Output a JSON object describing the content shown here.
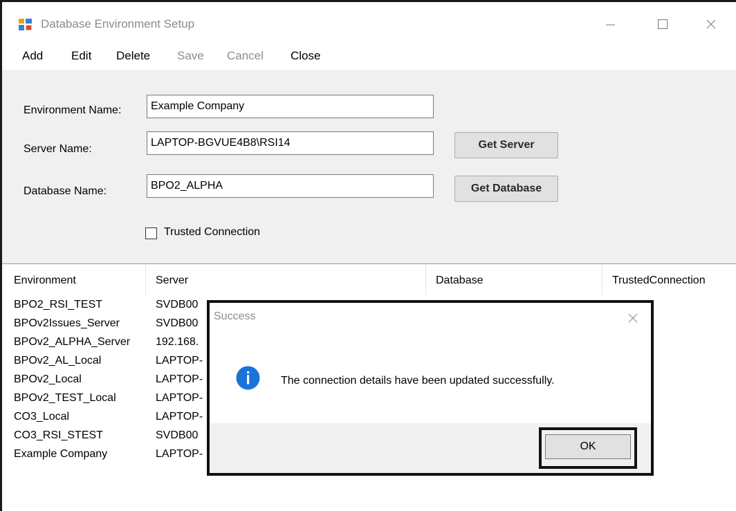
{
  "window": {
    "title": "Database Environment Setup"
  },
  "menu": {
    "add": "Add",
    "edit": "Edit",
    "delete": "Delete",
    "save": "Save",
    "cancel": "Cancel",
    "close": "Close"
  },
  "form": {
    "environment_label": "Environment Name:",
    "environment_value": "Example Company",
    "server_label": "Server Name:",
    "server_value": "LAPTOP-BGVUE4B8\\RSI14",
    "database_label": "Database Name:",
    "database_value": "BPO2_ALPHA",
    "get_server": "Get Server",
    "get_database": "Get Database",
    "trusted_label": "Trusted Connection",
    "trusted_checked": false
  },
  "list": {
    "columns": [
      "Environment",
      "Server",
      "Database",
      "TrustedConnection"
    ],
    "rows": [
      {
        "environment": "BPO2_RSI_TEST",
        "server": "SVDB00"
      },
      {
        "environment": "BPOv2Issues_Server",
        "server": "SVDB00"
      },
      {
        "environment": "BPOv2_ALPHA_Server",
        "server": "192.168."
      },
      {
        "environment": "BPOv2_AL_Local",
        "server": "LAPTOP-"
      },
      {
        "environment": "BPOv2_Local",
        "server": "LAPTOP-"
      },
      {
        "environment": "BPOv2_TEST_Local",
        "server": "LAPTOP-"
      },
      {
        "environment": "CO3_Local",
        "server": "LAPTOP-"
      },
      {
        "environment": "CO3_RSI_STEST",
        "server": "SVDB00"
      },
      {
        "environment": "Example Company",
        "server": "LAPTOP-"
      }
    ]
  },
  "dialog": {
    "title": "Success",
    "message": "The connection details have been updated successfully.",
    "ok": "OK",
    "icon": "info-icon"
  },
  "colors": {
    "info_blue": "#1a73d9",
    "disabled_text": "#8d8d8d"
  }
}
